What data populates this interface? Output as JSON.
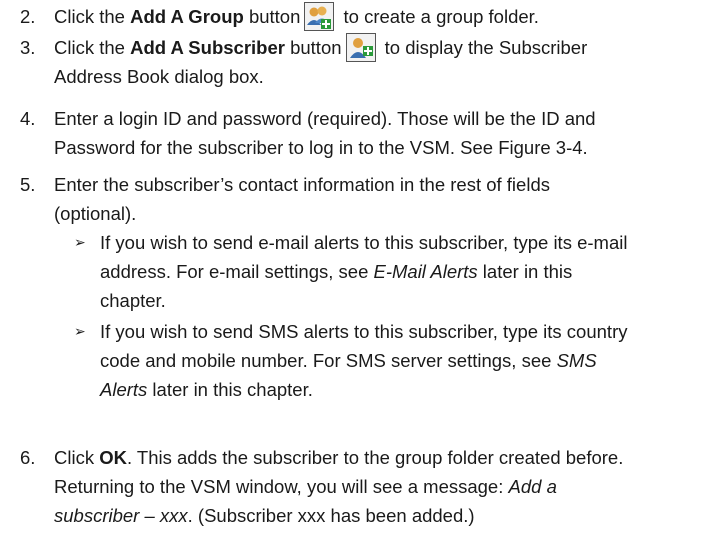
{
  "steps": [
    {
      "num": "2.",
      "t1": "Click the ",
      "bold": "Add A Group",
      "t2": " button",
      "icon": "add-group-icon",
      "t3": " to create a group folder."
    },
    {
      "num": "3.",
      "t1": "Click the ",
      "bold": "Add A Subscriber",
      "t2": " button",
      "icon": "add-subscriber-icon",
      "t3": " to display the Subscriber",
      "line2": "Address Book dialog box."
    },
    {
      "num": "4.",
      "line1": "Enter a login ID and password (required). Those will be the ID and",
      "line2": "Password for the subscriber to log in to the VSM. See Figure 3-4."
    },
    {
      "num": "5.",
      "line1": "Enter the subscriber’s contact information in the rest of fields",
      "line2": "(optional).",
      "bullets": [
        {
          "l1": "If you wish to send e-mail alerts to this subscriber, type its e-mail",
          "l2a": "address. For e-mail settings, see ",
          "l2i": "E-Mail Alerts",
          "l2b": " later in this",
          "l3": "chapter."
        },
        {
          "l1": "If you wish to send SMS alerts to this subscriber, type its country",
          "l2a": "code and mobile number. For SMS server settings, see ",
          "l2i": "SMS",
          "l3i": "Alerts",
          "l3b": " later in this chapter."
        }
      ]
    },
    {
      "num": "6.",
      "l1a": "Click ",
      "l1bold": "OK",
      "l1b": ". This adds the subscriber to the group folder created before.",
      "l2a": "Returning to the VSM window, you will see a message: ",
      "l2i": "Add a",
      "l3i": "subscriber – xxx",
      "l3b": ". (Subscriber xxx has been added.)"
    }
  ],
  "bullet_glyph": "➢"
}
